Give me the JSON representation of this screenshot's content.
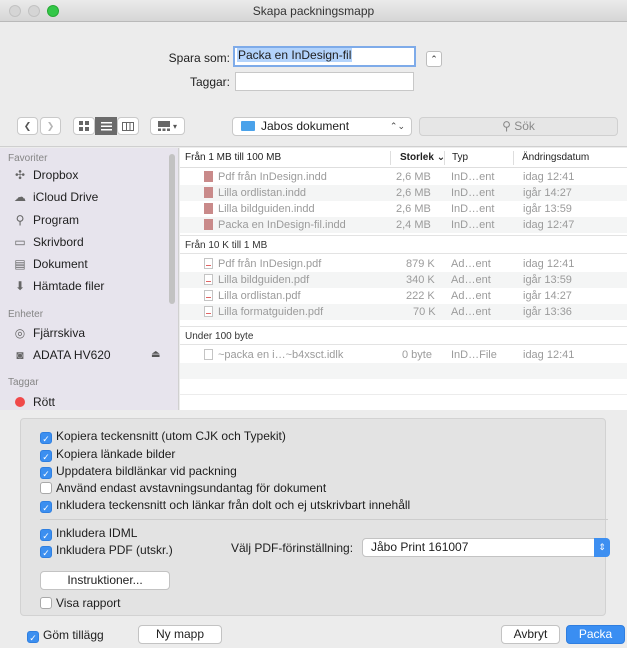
{
  "window": {
    "title": "Skapa packningsmapp"
  },
  "save": {
    "save_as_label": "Spara som:",
    "save_as_value": "Packa en InDesign-fil",
    "tags_label": "Taggar:",
    "tags_value": "",
    "collapse_glyph": "⌃"
  },
  "toolbar": {
    "back_glyph": "❮",
    "forward_glyph": "❯",
    "view_modes": [
      "icon-view",
      "list-view",
      "column-view",
      "gallery-view"
    ],
    "location": "Jabos dokument",
    "search_placeholder": "Sök"
  },
  "sidebar": {
    "sections": [
      {
        "title": "Favoriter",
        "items": [
          {
            "label": "Dropbox",
            "icon": "dropbox-icon"
          },
          {
            "label": "iCloud Drive",
            "icon": "cloud-icon"
          },
          {
            "label": "Program",
            "icon": "applications-icon"
          },
          {
            "label": "Skrivbord",
            "icon": "desktop-icon"
          },
          {
            "label": "Dokument",
            "icon": "document-icon"
          },
          {
            "label": "Hämtade filer",
            "icon": "download-icon"
          }
        ]
      },
      {
        "title": "Enheter",
        "items": [
          {
            "label": "Fjärrskiva",
            "icon": "remote-disc-icon"
          },
          {
            "label": "ADATA HV620",
            "icon": "external-drive-icon"
          }
        ]
      },
      {
        "title": "Taggar",
        "items": [
          {
            "label": "Rött",
            "icon": "red-tag-icon"
          }
        ]
      }
    ]
  },
  "filelist": {
    "columns": {
      "name": "Från 1 MB till 100 MB",
      "size": "Storlek",
      "type": "Typ",
      "date": "Ändringsdatum"
    },
    "groups": [
      {
        "title": "Från 1 MB till 100 MB",
        "rows": [
          {
            "name": "Pdf från InDesign.indd",
            "size": "2,6 MB",
            "type": "InD…ent",
            "date": "idag 12:41",
            "kind": "indd"
          },
          {
            "name": "Lilla ordlistan.indd",
            "size": "2,6 MB",
            "type": "InD…ent",
            "date": "igår 14:27",
            "kind": "indd"
          },
          {
            "name": "Lilla bildguiden.indd",
            "size": "2,6 MB",
            "type": "InD…ent",
            "date": "igår 13:59",
            "kind": "indd"
          },
          {
            "name": "Packa en InDesign-fil.indd",
            "size": "2,4 MB",
            "type": "InD…ent",
            "date": "idag 12:47",
            "kind": "indd"
          }
        ]
      },
      {
        "title": "Från 10 K till 1 MB",
        "rows": [
          {
            "name": "Pdf från InDesign.pdf",
            "size": "879 K",
            "type": "Ad…ent",
            "date": "idag 12:41",
            "kind": "pdf"
          },
          {
            "name": "Lilla bildguiden.pdf",
            "size": "340 K",
            "type": "Ad…ent",
            "date": "igår 13:59",
            "kind": "pdf"
          },
          {
            "name": "Lilla ordlistan.pdf",
            "size": "222 K",
            "type": "Ad…ent",
            "date": "igår 14:27",
            "kind": "pdf"
          },
          {
            "name": "Lilla formatguiden.pdf",
            "size": "70 K",
            "type": "Ad…ent",
            "date": "igår 13:36",
            "kind": "pdf"
          }
        ]
      },
      {
        "title": "Under 100 byte",
        "rows": [
          {
            "name": "~packa en i…~b4xsct.idlk",
            "size": "0 byte",
            "type": "InD…File",
            "date": "idag 12:41",
            "kind": "idlk"
          }
        ]
      }
    ]
  },
  "options": {
    "checkboxes": [
      {
        "label": "Kopiera teckensnitt (utom CJK och Typekit)",
        "checked": true
      },
      {
        "label": "Kopiera länkade bilder",
        "checked": true
      },
      {
        "label": "Uppdatera bildlänkar vid packning",
        "checked": true
      },
      {
        "label": "Använd endast avstavningsundantag för dokument",
        "checked": false
      },
      {
        "label": "Inkludera teckensnitt och länkar från dolt och ej utskrivbart innehåll",
        "checked": true
      }
    ],
    "include_idml": {
      "label": "Inkludera IDML",
      "checked": true
    },
    "include_pdf": {
      "label": "Inkludera PDF (utskr.)",
      "checked": true
    },
    "pdf_preset_label": "Välj PDF-förinställning:",
    "pdf_preset_value": "Jåbo Print 161007",
    "instructions_button": "Instruktioner...",
    "show_report": {
      "label": "Visa rapport",
      "checked": false
    }
  },
  "footer": {
    "hide_extension": {
      "label": "Göm tillägg",
      "checked": true
    },
    "new_folder_button": "Ny mapp",
    "cancel_button": "Avbryt",
    "pack_button": "Packa"
  },
  "colors": {
    "accent": "#3a8ef2",
    "sidebar_bg": "#e7e4ed",
    "tag_red": "#f0494a"
  }
}
